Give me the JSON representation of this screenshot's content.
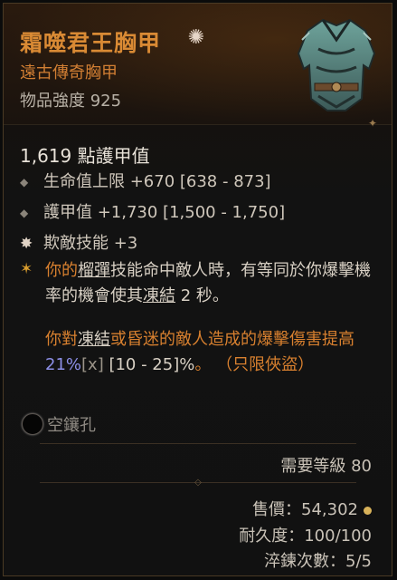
{
  "item": {
    "name": "霜噬君王胸甲",
    "type": "遠古傳奇胸甲",
    "power": "物品強度 925"
  },
  "stats": {
    "armor": "1,619 點護甲值",
    "lines": [
      "生命值上限 +670 [638 - 873]",
      "護甲值 +1,730 [1,500 - 1,750]",
      "欺敵技能 +3"
    ]
  },
  "aspect": {
    "p1": {
      "a": "你的",
      "b": "榴彈",
      "c": "技能命中敵人時，有等同於你爆擊機率的機會使其",
      "d": "凍結",
      "e": " 2 秒。"
    },
    "p2": {
      "a": "你對",
      "b": "凍結",
      "c": "或昏迷的敵人造成的爆擊傷害提高 ",
      "d": "21%",
      "e": "[x]",
      "f": " [10 - 25]%",
      "g": "。 （只限俠盜）"
    }
  },
  "socket": {
    "label": "空鑲孔"
  },
  "requirement": "需要等級 80",
  "footer": {
    "price": "售價：54,302",
    "durability": "耐久度：100/100",
    "tempers": "淬鍊次數：5/5"
  },
  "colors": {
    "legendary": "#d98a34",
    "value_blue": "#8d90e8"
  }
}
